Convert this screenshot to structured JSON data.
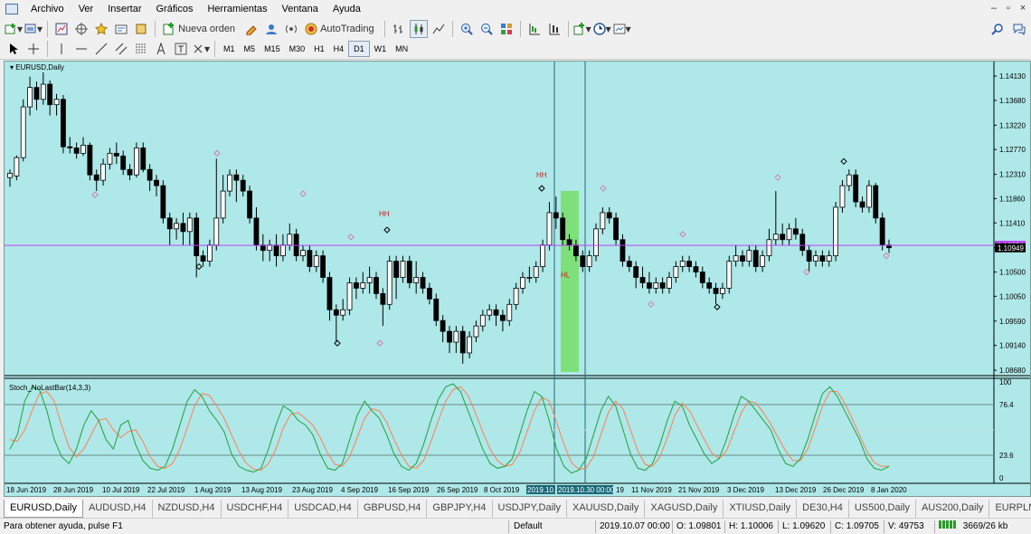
{
  "menu": [
    "Archivo",
    "Ver",
    "Insertar",
    "Gráficos",
    "Herramientas",
    "Ventana",
    "Ayuda"
  ],
  "toolbar": {
    "new_order": "Nueva orden",
    "autotrading": "AutoTrading"
  },
  "timeframes": [
    "M1",
    "M5",
    "M15",
    "M30",
    "H1",
    "H4",
    "D1",
    "W1",
    "MN"
  ],
  "active_timeframe": "D1",
  "chart": {
    "title": "EURUSD,Daily",
    "indicator_title": "Stoch_NoLastBar(14,3,3)",
    "price_axis": [
      "1.14130",
      "1.13680",
      "1.13220",
      "1.12770",
      "1.12310",
      "1.11860",
      "1.11410",
      "1.10950",
      "1.10500",
      "1.10050",
      "1.09590",
      "1.09140",
      "1.08680"
    ],
    "current_price_tag": "1.10994",
    "bid_tag": "1.10949",
    "indicator_axis": [
      "100",
      "76.4",
      "23.6",
      "0"
    ],
    "date_axis": [
      "18 Jun 2019",
      "28 Jun 2019",
      "10 Jul 2019",
      "22 Jul 2019",
      "1 Aug 2019",
      "13 Aug 2019",
      "23 Aug 2019",
      "4 Sep 2019",
      "16 Sep 2019",
      "26 Sep 2019",
      "8 Oct 2019",
      "2019.10.",
      "2019.10.30 00:00",
      "19",
      "11 Nov 2019",
      "21 Nov 2019",
      "3 Dec 2019",
      "13 Dec 2019",
      "26 Dec 2019",
      "8 Jan 2020"
    ],
    "annotations": [
      "HH",
      "HH",
      "HL"
    ],
    "colors": {
      "background": "#afe8e8",
      "bull": "#ffffff",
      "bear": "#000000",
      "level_line": "#c040ff",
      "stoch_main": "#20a040",
      "stoch_signal": "#ff7f50",
      "highlight": "#7ee07a"
    }
  },
  "tabs": [
    "EURUSD,Daily",
    "AUDUSD,H4",
    "NZDUSD,H4",
    "USDCHF,H4",
    "USDCAD,H4",
    "GBPUSD,H4",
    "GBPJPY,H4",
    "USDJPY,Daily",
    "XAUUSD,Daily",
    "XAGUSD,Daily",
    "XTIUSD,Daily",
    "DE30,H4",
    "US500,Daily",
    "AUS200,Daily",
    "EURPLN,Daily"
  ],
  "active_tab": "EURUSD,Daily",
  "status": {
    "help": "Para obtener ayuda, pulse F1",
    "profile": "Default",
    "datetime": "2019.10.07 00:00",
    "open": "O: 1.09801",
    "high": "H: 1.10006",
    "low": "L: 1.09620",
    "close": "C: 1.09705",
    "volume": "V: 49753",
    "traffic": "3669/26 kb"
  }
}
